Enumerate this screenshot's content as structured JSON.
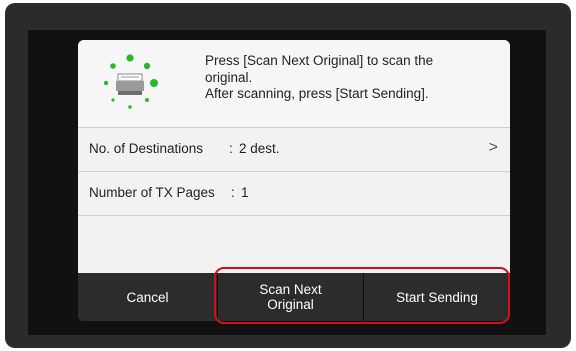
{
  "dialog": {
    "message_lines": [
      "Press [Scan Next Original] to scan the",
      "original.",
      "After scanning, press [Start Sending]."
    ],
    "icon": "scanner-icon"
  },
  "rows": [
    {
      "label": "No. of Destinations",
      "separator": ":",
      "value": "2 dest.",
      "chevron": ">"
    },
    {
      "label": "Number of TX Pages",
      "separator": ":",
      "value": "1"
    }
  ],
  "buttons": {
    "cancel": "Cancel",
    "scan_next_line1": "Scan Next",
    "scan_next_line2": "Original",
    "start_sending": "Start Sending"
  },
  "colors": {
    "highlight": "#d0101a",
    "icon_green": "#2db52d",
    "button_bg": "#2c2c2c"
  }
}
